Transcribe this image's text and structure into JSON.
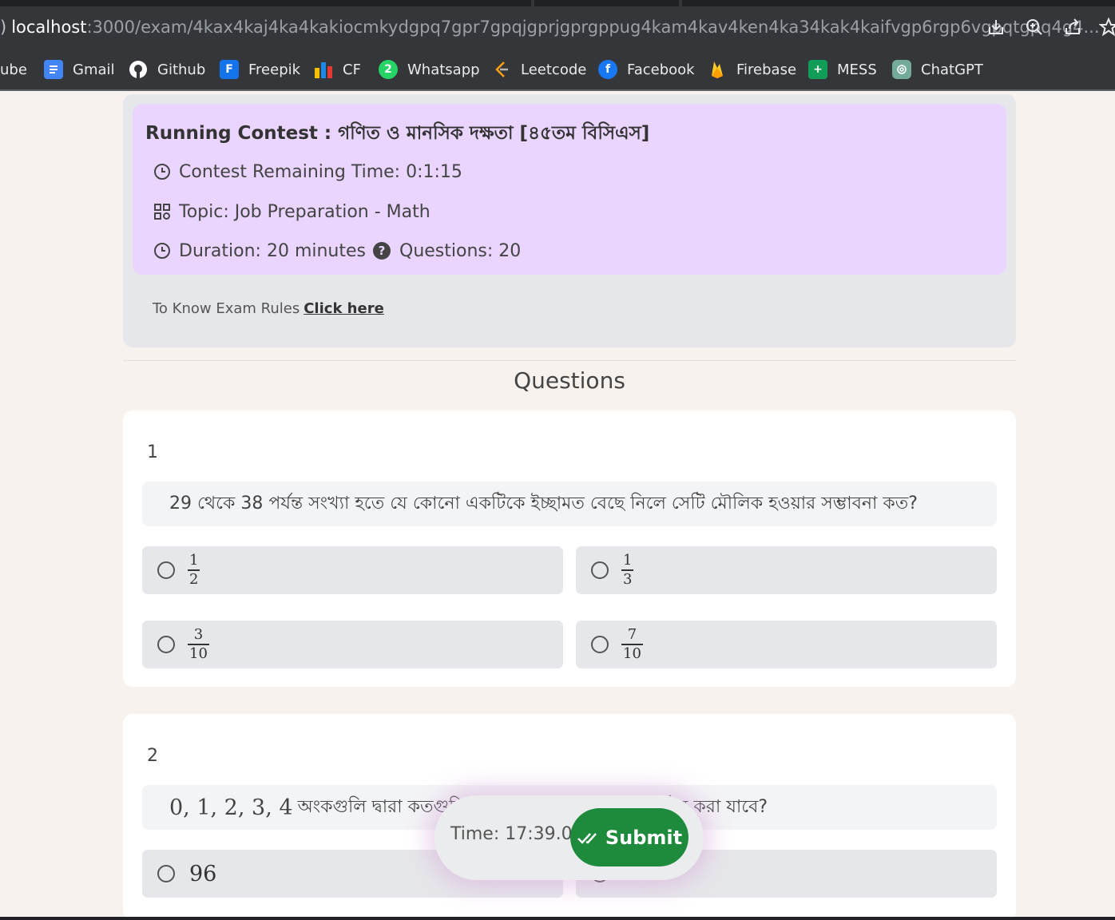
{
  "browser": {
    "url_lead": ")",
    "url_host": "localhost",
    "url_path": ":3000/exam/4kax4kaj4ka4kakiocmkydgpq7gpr7gpqjgprjgprgppug4kam4kav4ken4ka34kak4kaifvgp6rgp6vgpqtgpq4g4...",
    "toolbar_icons": [
      "download-icon",
      "zoom-icon",
      "share-icon",
      "star-icon"
    ],
    "bookmarks": [
      {
        "label": "ube",
        "icon": "youtube-icon",
        "color": "#ff0000"
      },
      {
        "label": "Gmail",
        "icon": "gmail-doc-icon",
        "color": "#4285f4"
      },
      {
        "label": "Github",
        "icon": "github-icon",
        "color": "#ffffff"
      },
      {
        "label": "Freepik",
        "icon": "freepik-icon",
        "color": "#1273eb"
      },
      {
        "label": "CF",
        "icon": "codeforces-icon",
        "color": "#f7c100"
      },
      {
        "label": "Whatsapp",
        "icon": "whatsapp-icon",
        "color": "#25d366"
      },
      {
        "label": "Leetcode",
        "icon": "leetcode-icon",
        "color": "#ffa116"
      },
      {
        "label": "Facebook",
        "icon": "facebook-icon",
        "color": "#1877f2"
      },
      {
        "label": "Firebase",
        "icon": "firebase-icon",
        "color": "#ffca28"
      },
      {
        "label": "MESS",
        "icon": "sheets-plus-icon",
        "color": "#0f9d58"
      },
      {
        "label": "ChatGPT",
        "icon": "chatgpt-icon",
        "color": "#74aa9c"
      }
    ]
  },
  "contest": {
    "title": "Running Contest : গণিত ও মানসিক দক্ষতা [৪৫তম বিসিএস]",
    "remaining_time": "Contest Remaining Time: 0:1:15",
    "topic": "Topic: Job Preparation - Math",
    "duration": "Duration: 20 minutes",
    "questions": "Questions: 20",
    "rules_prefix": "To Know Exam Rules",
    "rules_link": "Click here"
  },
  "questions_heading": "Questions",
  "questions": [
    {
      "number": "1",
      "text": "29 থেকে 38 পর্যন্ত সংখ্যা হতে যে কোনো একটিকে ইচ্ছামত বেছে নিলে সেটি মৌলিক হওয়ার সম্ভাবনা কত?",
      "options": [
        {
          "num": "1",
          "den": "2"
        },
        {
          "num": "1",
          "den": "3"
        },
        {
          "num": "3",
          "den": "10"
        },
        {
          "num": "7",
          "den": "10"
        }
      ]
    },
    {
      "number": "2",
      "text_math": "0, 1, 2, 3, 4",
      "text": "অংকগুলি দ্বারা কতগুলি                                    ঠন করা যাবে?",
      "options": [
        {
          "value": "96"
        },
        {
          "value": ""
        }
      ]
    }
  ],
  "float_bar": {
    "timer": "Time: 17:39.0",
    "submit_label": "Submit"
  },
  "colors": {
    "contest_box": "#e6e7ea",
    "contest_inner": "#e9d5ff",
    "submit": "#1e8a3c",
    "page_bg": "#f7f2ee"
  }
}
